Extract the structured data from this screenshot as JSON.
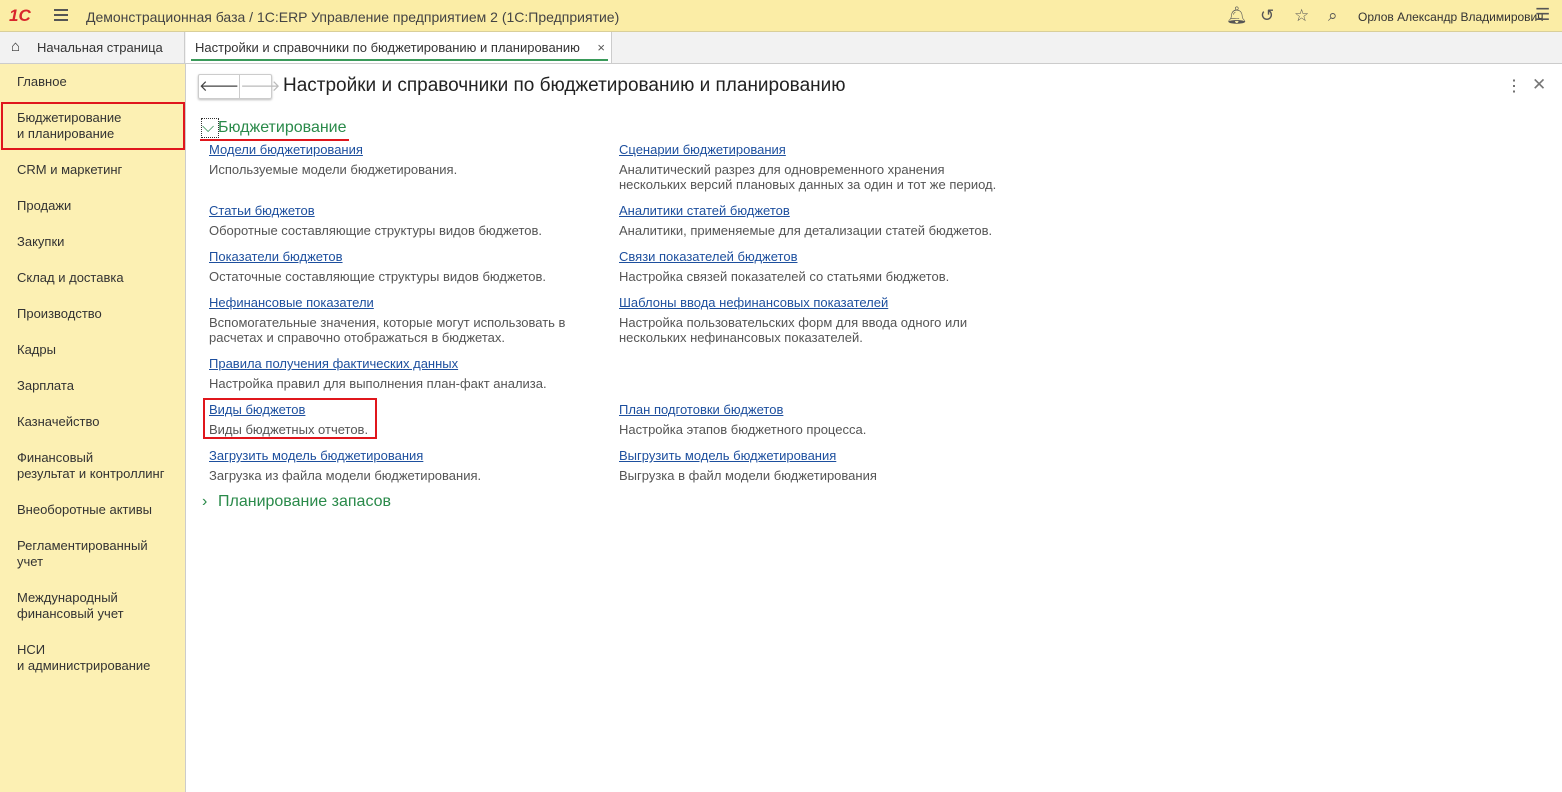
{
  "titlebar": {
    "logo": "1С",
    "title": "Демонстрационная база / 1С:ERP Управление предприятием 2  (1С:Предприятие)",
    "user": "Орлов Александр Владимирович"
  },
  "tabs": {
    "home": "Начальная страница",
    "active": "Настройки и справочники по бюджетированию и планированию"
  },
  "sidebar": [
    "Главное",
    "Бюджетирование\nи планирование",
    "CRM и маркетинг",
    "Продажи",
    "Закупки",
    "Склад и доставка",
    "Производство",
    "Кадры",
    "Зарплата",
    "Казначейство",
    "Финансовый\nрезультат и контроллинг",
    "Внеоборотные активы",
    "Регламентированный\nучет",
    "Международный\nфинансовый учет",
    "НСИ\nи администрирование"
  ],
  "page": {
    "title": "Настройки и справочники по бюджетированию и планированию",
    "group1": "Бюджетирование",
    "group2": "Планирование запасов",
    "items": [
      {
        "link": "Модели бюджетирования",
        "desc": "Используемые модели бюджетирования."
      },
      {
        "link": "Сценарии бюджетирования",
        "desc": "Аналитический разрез для одновременного хранения нескольких версий плановых данных за один и тот же период."
      },
      {
        "link": "Статьи бюджетов",
        "desc": "Оборотные составляющие структуры видов бюджетов."
      },
      {
        "link": "Аналитики статей бюджетов",
        "desc": "Аналитики, применяемые для детализации статей бюджетов."
      },
      {
        "link": "Показатели бюджетов",
        "desc": "Остаточные составляющие структуры видов бюджетов."
      },
      {
        "link": "Связи показателей бюджетов",
        "desc": "Настройка связей показателей со статьями бюджетов."
      },
      {
        "link": "Нефинансовые показатели",
        "desc": "Вспомогательные значения, которые могут использовать в расчетах и справочно отображаться в бюджетах."
      },
      {
        "link": "Шаблоны ввода нефинансовых показателей",
        "desc": "Настройка пользовательских форм для ввода одного или нескольких нефинансовых показателей."
      },
      {
        "link": "Правила получения фактических данных",
        "desc": "Настройка правил для выполнения план-факт анализа."
      },
      {
        "link": "Виды бюджетов",
        "desc": "Виды бюджетных отчетов."
      },
      {
        "link": "План подготовки бюджетов",
        "desc": "Настройка этапов бюджетного процесса."
      },
      {
        "link": "Загрузить модель бюджетирования",
        "desc": "Загрузка из файла модели бюджетирования."
      },
      {
        "link": "Выгрузить модель бюджетирования",
        "desc": "Выгрузка в файл модели бюджетирования"
      }
    ]
  }
}
